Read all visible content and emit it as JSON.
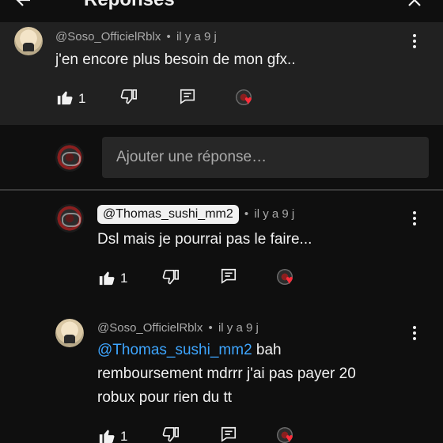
{
  "header": {
    "title": "Réponses",
    "back_icon": "arrow-left-icon",
    "close_icon": "close-icon"
  },
  "parent_comment": {
    "author": "@Soso_OfficielRblx",
    "time": "il y a 9 j",
    "text": "j'en encore plus besoin de mon gfx..",
    "likes": "1"
  },
  "reply_input": {
    "placeholder": "Ajouter une réponse…"
  },
  "replies": [
    {
      "author": "@Thomas_sushi_mm2",
      "time": "il y a 9 j",
      "text": "Dsl mais je pourrai pas le faire...",
      "likes": "1"
    },
    {
      "author": "@Soso_OfficielRblx",
      "time": "il y a 9 j",
      "mention": "@Thomas_sushi_mm2",
      "text_after_mention": " bah",
      "text_line2": "remboursement mdrrr j'ai pas payer 20",
      "text_line3": "robux pour rien du tt",
      "likes": "1"
    }
  ],
  "separator": "•",
  "colors": {
    "background": "#0f0f0f",
    "highlight": "#212121",
    "mention": "#3ea6ff",
    "heart": "#ff2d3b"
  }
}
